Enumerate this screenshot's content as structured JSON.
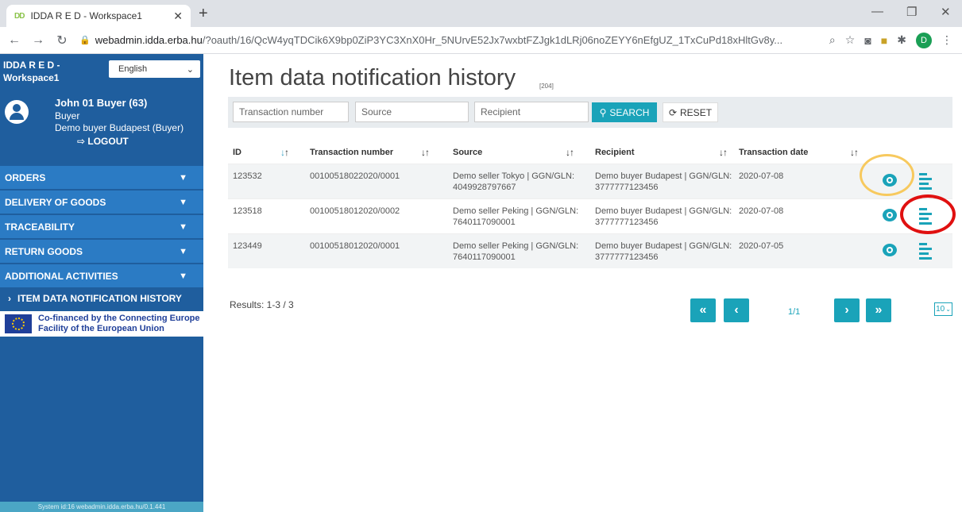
{
  "browser": {
    "tab_title": "IDDA R E D - Workspace1",
    "favicon": "DD",
    "url_host": "webadmin.idda.erba.hu",
    "url_path": "/?oauth/16/QcW4yqTDCik6X9bp0ZiP3YC3XnX0Hr_5NUrvE52Jx7wxbtFZJgk1dLRj06noZEYY6nEfgUZ_1TxCuPd18xHltGv8y...",
    "profile_initial": "D"
  },
  "sidebar": {
    "workspace": "IDDA R E D - Workspace1",
    "language": "English",
    "user_name": "John 01 Buyer (63)",
    "user_role": "Buyer",
    "user_org": "Demo buyer Budapest (Buyer)",
    "logout": "LOGOUT",
    "menu": [
      {
        "label": "ORDERS"
      },
      {
        "label": "DELIVERY OF GOODS"
      },
      {
        "label": "TRACEABILITY"
      },
      {
        "label": "RETURN GOODS"
      },
      {
        "label": "ADDITIONAL ACTIVITIES"
      }
    ],
    "active_item": "ITEM DATA NOTIFICATION HISTORY",
    "eu_line1": "Co-financed by the Connecting Europe",
    "eu_line2": "Facility of the European Union",
    "system_info": "System id:16 webadmin.idda.erba.hu/0.1.441"
  },
  "main": {
    "title": "Item data notification history",
    "count": "[204]",
    "filters": {
      "transaction_placeholder": "Transaction number",
      "source_placeholder": "Source",
      "recipient_placeholder": "Recipient",
      "search_label": "SEARCH",
      "reset_label": "RESET"
    },
    "columns": {
      "id": "ID",
      "transaction": "Transaction number",
      "source": "Source",
      "recipient": "Recipient",
      "date": "Transaction date"
    },
    "rows": [
      {
        "id": "123532",
        "transaction": "00100518022020/0001",
        "source1": "Demo seller Tokyo | GGN/GLN:",
        "source2": "4049928797667",
        "recipient1": "Demo buyer Budapest | GGN/GLN:",
        "recipient2": "3777777123456",
        "date": "2020-07-08"
      },
      {
        "id": "123518",
        "transaction": "00100518012020/0002",
        "source1": "Demo seller Peking | GGN/GLN:",
        "source2": "7640117090001",
        "recipient1": "Demo buyer Budapest | GGN/GLN:",
        "recipient2": "3777777123456",
        "date": "2020-07-08"
      },
      {
        "id": "123449",
        "transaction": "00100518012020/0001",
        "source1": "Demo seller Peking | GGN/GLN:",
        "source2": "7640117090001",
        "recipient1": "Demo buyer Budapest | GGN/GLN:",
        "recipient2": "3777777123456",
        "date": "2020-07-05"
      }
    ],
    "results": "Results: 1-3 / 3",
    "page_info": "1/1",
    "page_size": "10"
  },
  "colors": {
    "sidebar": "#1f5e9e",
    "menu": "#2b7bc4",
    "accent": "#1aa3b9",
    "highlight_yellow": "#f7c95e",
    "highlight_red": "#e01010"
  }
}
